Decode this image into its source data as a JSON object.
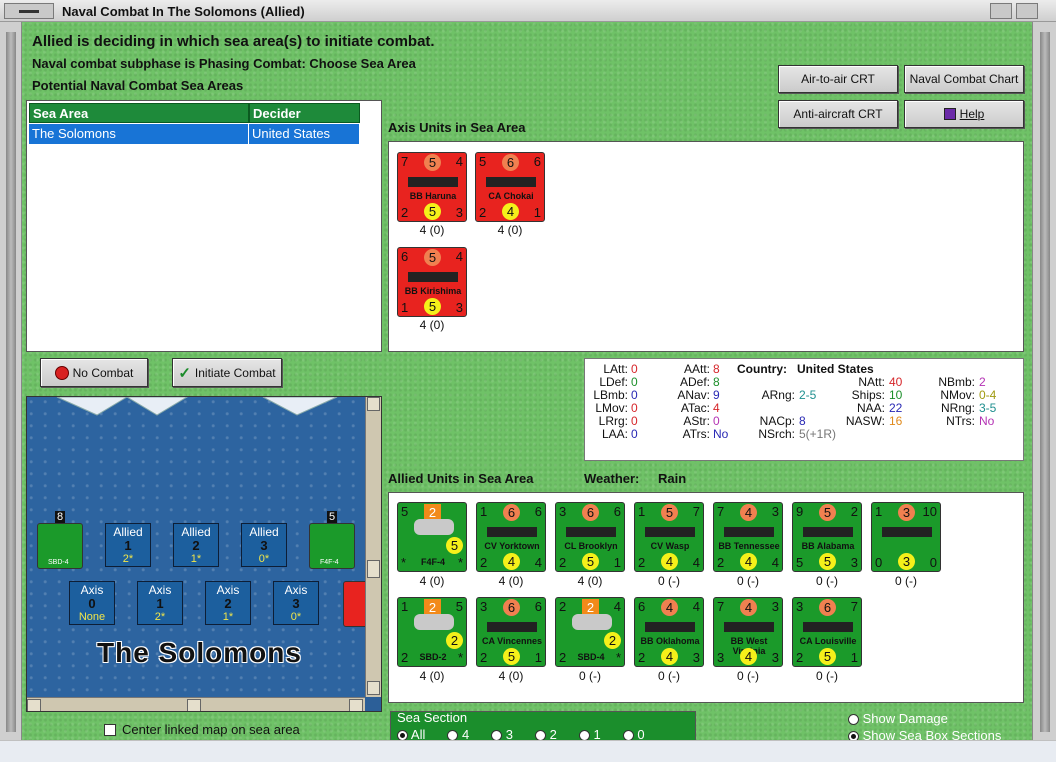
{
  "window": {
    "title": "Naval Combat In The Solomons (Allied)"
  },
  "header": {
    "line1": "Allied is deciding in which sea area(s) to initiate combat.",
    "line2": "Naval combat subphase is Phasing Combat: Choose Sea Area",
    "line3": "Potential Naval Combat Sea Areas"
  },
  "buttons": {
    "air_to_air": "Air-to-air CRT",
    "naval_chart": "Naval Combat Chart",
    "anti_aircraft": "Anti-aircraft CRT",
    "help": "Help",
    "no_combat": "No Combat",
    "initiate_combat": "Initiate Combat"
  },
  "sea_table": {
    "headers": [
      "Sea Area",
      "Decider"
    ],
    "rows": [
      [
        "The Solomons",
        "United States"
      ]
    ]
  },
  "axis_units": {
    "label": "Axis Units in Sea Area",
    "units": [
      {
        "name": "BB Haruna",
        "tl": "7",
        "tc": "5",
        "tr": "4",
        "bl": "2",
        "bc": "5",
        "br": "3",
        "caption": "4 (0)"
      },
      {
        "name": "CA Chokai",
        "tl": "5",
        "tc": "6",
        "tr": "6",
        "bl": "2",
        "bc": "4",
        "br": "1",
        "caption": "4 (0)"
      },
      {
        "name": "BB Kirishima",
        "tl": "6",
        "tc": "5",
        "tr": "4",
        "bl": "1",
        "bc": "5",
        "br": "3",
        "caption": "4 (0)"
      }
    ]
  },
  "allied_units": {
    "label": "Allied Units in Sea Area",
    "weather_label": "Weather:",
    "weather": "Rain",
    "row1": [
      {
        "name": "F4F-4",
        "tl": "5",
        "tc": "2",
        "tr": "",
        "bl": "*",
        "bc": "5",
        "br": "*",
        "caption": "4 (0)",
        "kind": "air"
      },
      {
        "name": "CV Yorktown",
        "tl": "1",
        "tc": "6",
        "tr": "6",
        "bl": "2",
        "bc": "4",
        "br": "4",
        "caption": "4 (0)",
        "kind": "ship"
      },
      {
        "name": "CL Brooklyn",
        "tl": "3",
        "tc": "6",
        "tr": "6",
        "bl": "2",
        "bc": "5",
        "br": "1",
        "caption": "4 (0)",
        "kind": "ship"
      },
      {
        "name": "CV Wasp",
        "tl": "1",
        "tc": "5",
        "tr": "7",
        "bl": "2",
        "bc": "4",
        "br": "4",
        "caption": "0 (-)",
        "kind": "ship"
      },
      {
        "name": "BB Tennessee",
        "tl": "7",
        "tc": "4",
        "tr": "3",
        "bl": "2",
        "bc": "4",
        "br": "4",
        "caption": "0 (-)",
        "kind": "ship"
      },
      {
        "name": "BB Alabama",
        "tl": "9",
        "tc": "5",
        "tr": "2",
        "bl": "5",
        "bc": "5",
        "br": "3",
        "caption": "0 (-)",
        "kind": "ship"
      },
      {
        "name": "",
        "tl": "1",
        "tc": "3",
        "tr": "10",
        "bl": "0",
        "bc": "3",
        "br": "0",
        "caption": "0 (-)",
        "kind": "ship"
      }
    ],
    "row2": [
      {
        "name": "SBD-2",
        "tl": "1",
        "tc": "2",
        "tr": "5",
        "bl": "2",
        "bc": "2",
        "br": "*",
        "caption": "4 (0)",
        "kind": "air"
      },
      {
        "name": "CA Vincennes",
        "tl": "3",
        "tc": "6",
        "tr": "6",
        "bl": "2",
        "bc": "5",
        "br": "1",
        "caption": "4 (0)",
        "kind": "ship"
      },
      {
        "name": "SBD-4",
        "tl": "2",
        "tc": "2",
        "tr": "4",
        "bl": "2",
        "bc": "2",
        "br": "*",
        "caption": "0 (-)",
        "kind": "air"
      },
      {
        "name": "BB Oklahoma",
        "tl": "6",
        "tc": "4",
        "tr": "4",
        "bl": "2",
        "bc": "4",
        "br": "3",
        "caption": "0 (-)",
        "kind": "ship"
      },
      {
        "name": "BB West Virginia",
        "tl": "7",
        "tc": "4",
        "tr": "3",
        "bl": "3",
        "bc": "4",
        "br": "3",
        "caption": "0 (-)",
        "kind": "ship"
      },
      {
        "name": "CA Louisville",
        "tl": "3",
        "tc": "6",
        "tr": "7",
        "bl": "2",
        "bc": "5",
        "br": "1",
        "caption": "0 (-)",
        "kind": "ship"
      }
    ]
  },
  "stats": {
    "country_label": "Country:",
    "country": "United States",
    "col1": [
      [
        "LAtt:",
        "0"
      ],
      [
        "LDef:",
        "0"
      ],
      [
        "LBmb:",
        "0"
      ],
      [
        "LMov:",
        "0"
      ],
      [
        "LRrg:",
        "0"
      ],
      [
        "LAA:",
        "0"
      ]
    ],
    "col2": [
      [
        "AAtt:",
        "8"
      ],
      [
        "ADef:",
        "8"
      ],
      [
        "ANav:",
        "9"
      ],
      [
        "ATac:",
        "4"
      ],
      [
        "AStr:",
        "0"
      ],
      [
        "ATrs:",
        "No"
      ]
    ],
    "col3": [
      [
        "ARng:",
        "2-5"
      ],
      [
        "NACp:",
        "8"
      ],
      [
        "NSrch:",
        "5(+1R)"
      ]
    ],
    "col4": [
      [
        "NAtt:",
        "40"
      ],
      [
        "Ships:",
        "10"
      ],
      [
        "NAA:",
        "22"
      ],
      [
        "NASW:",
        "16"
      ]
    ],
    "col5": [
      [
        "NBmb:",
        "2"
      ],
      [
        "NMov:",
        "0-4"
      ],
      [
        "NRng:",
        "3-5"
      ],
      [
        "NTrs:",
        "No"
      ]
    ]
  },
  "map": {
    "title": "The Solomons",
    "allied_boxes": [
      {
        "label": "Allied",
        "num": "1",
        "sub": "2*"
      },
      {
        "label": "Allied",
        "num": "2",
        "sub": "1*"
      },
      {
        "label": "Allied",
        "num": "3",
        "sub": "0*"
      }
    ],
    "axis_boxes": [
      {
        "label": "Axis",
        "num": "0",
        "sub": "None"
      },
      {
        "label": "Axis",
        "num": "1",
        "sub": "2*"
      },
      {
        "label": "Axis",
        "num": "2",
        "sub": "1*"
      },
      {
        "label": "Axis",
        "num": "3",
        "sub": "0*"
      }
    ],
    "stack_left_count": "8",
    "stack_right_count": "5",
    "stack_left_name": "SBD-4",
    "stack_right_name": "F4F-4"
  },
  "center_checkbox": "Center linked map on sea area",
  "sea_section": {
    "label": "Sea Section",
    "options": [
      "All",
      "4",
      "3",
      "2",
      "1",
      "0"
    ],
    "selected": "All"
  },
  "toggles": {
    "show_damage": "Show Damage",
    "show_sections": "Show Sea Box Sections"
  }
}
